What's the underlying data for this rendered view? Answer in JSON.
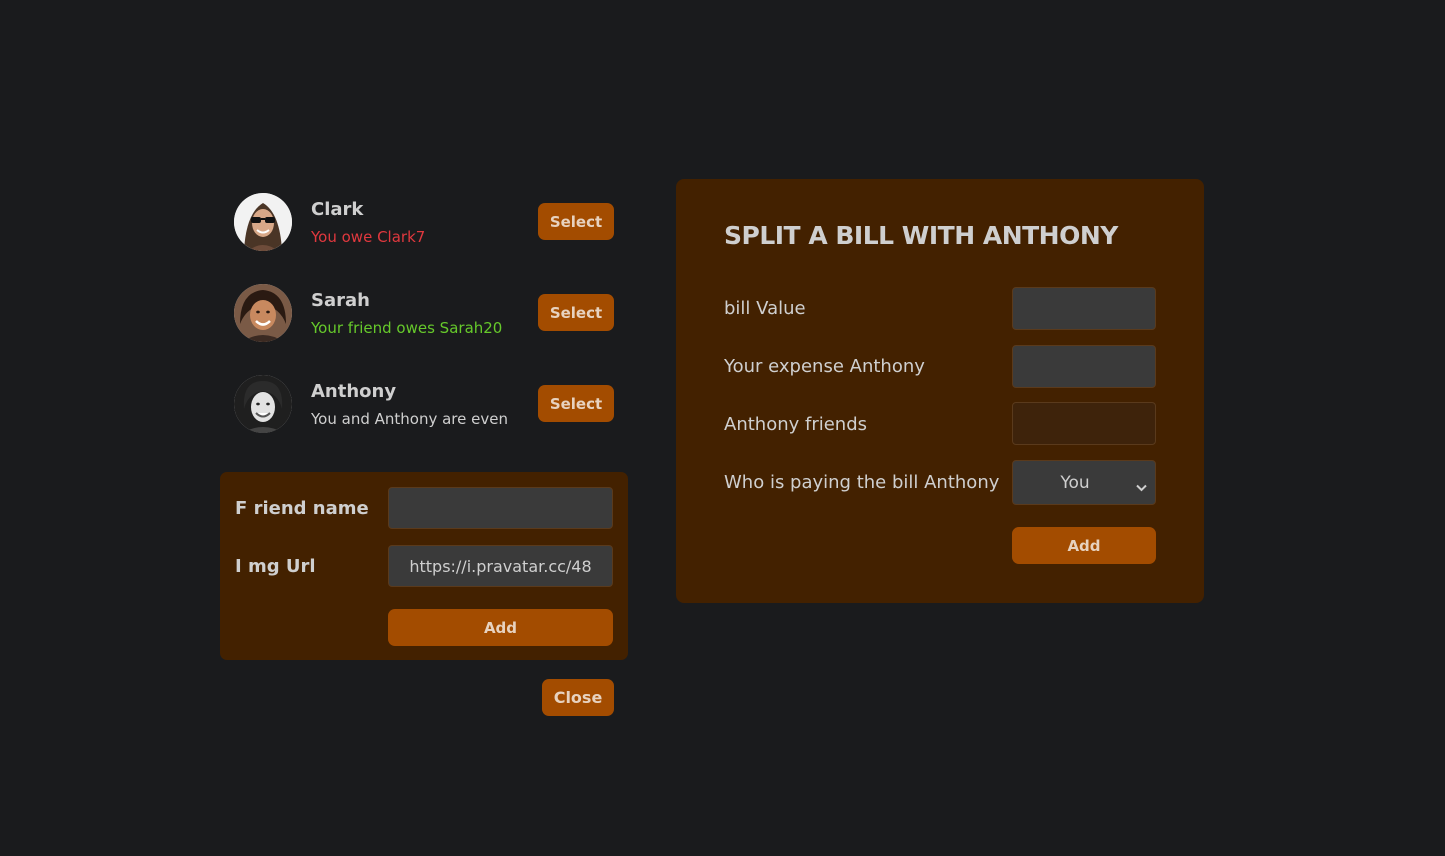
{
  "friends": [
    {
      "name": "Clark",
      "status": "You owe Clark7",
      "select_label": "Select"
    },
    {
      "name": "Sarah",
      "status": "Your friend owes Sarah20",
      "select_label": "Select"
    },
    {
      "name": "Anthony",
      "status": "You and Anthony are even",
      "select_label": "Select"
    }
  ],
  "add_friend": {
    "name_label": "F riend name",
    "name_value": "",
    "img_label": "I mg Url",
    "img_value": "https://i.pravatar.cc/48",
    "add_label": "Add"
  },
  "close_label": "Close",
  "split": {
    "title": "SPLIT A BILL WITH ANTHONY",
    "bill_label": "bill Value",
    "bill_value": "",
    "expense_label": "Your expense Anthony",
    "expense_value": "",
    "friend_expense_label": "Anthony friends",
    "friend_expense_value": "",
    "payer_label": "Who is paying the bill Anthony",
    "payer_value": "You",
    "add_label": "Add"
  },
  "colors": {
    "background": "#1a1b1d",
    "panel": "#432100",
    "accent": "#a34c00",
    "owe": "#e0383e",
    "owed": "#66c92b"
  },
  "icons": [
    "avatar-clark",
    "avatar-sarah",
    "avatar-anthony",
    "chevron-down-icon"
  ]
}
